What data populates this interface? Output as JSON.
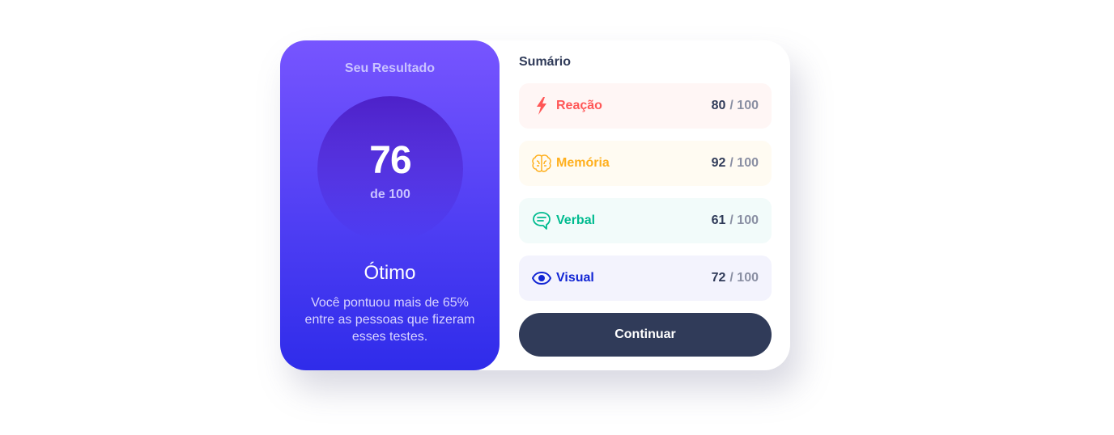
{
  "result": {
    "title": "Seu Resultado",
    "score": "76",
    "score_of": "de 100",
    "rating": "Ótimo",
    "description": "Você pontuou mais de 65% entre as pessoas que fizeram esses testes."
  },
  "summary": {
    "title": "Sumário",
    "items": [
      {
        "label": "Reação",
        "value": "80",
        "max": "/ 100",
        "icon": "lightning-icon",
        "color": "#ff5757",
        "bg": "#fff6f5"
      },
      {
        "label": "Memória",
        "value": "92",
        "max": "/ 100",
        "icon": "brain-icon",
        "color": "#ffb01f",
        "bg": "#fffbf2"
      },
      {
        "label": "Verbal",
        "value": "61",
        "max": "/ 100",
        "icon": "chat-bubble-icon",
        "color": "#00bb8f",
        "bg": "#f2fbfa"
      },
      {
        "label": "Visual",
        "value": "72",
        "max": "/ 100",
        "icon": "eye-icon",
        "color": "#1125d4",
        "bg": "#f3f3fd"
      }
    ]
  },
  "continue_label": "Continuar",
  "colors": {
    "gradient_start": "#7755ff",
    "gradient_end": "#2f2cea",
    "button_bg": "#303b59"
  }
}
